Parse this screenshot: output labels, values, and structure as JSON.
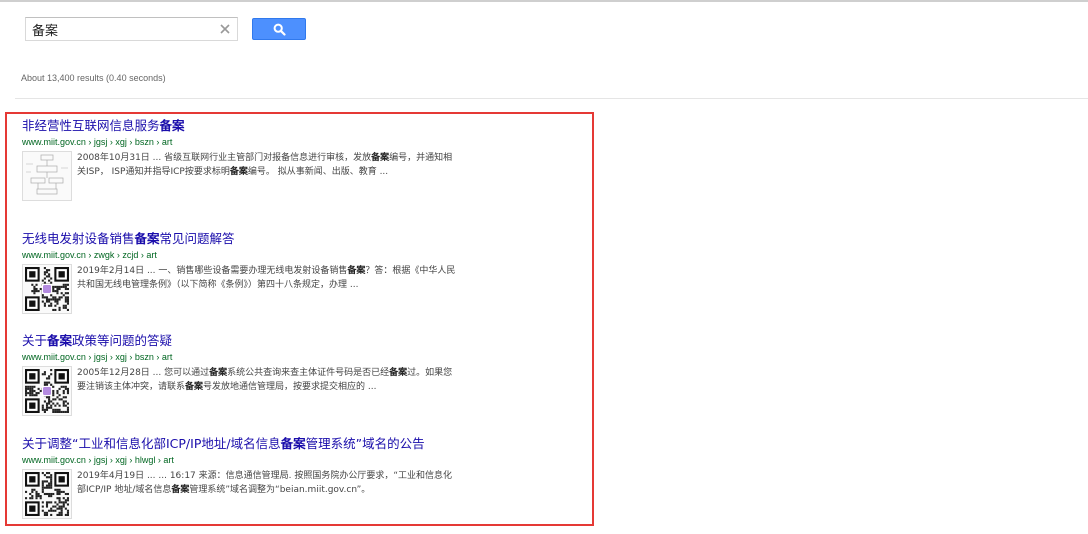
{
  "search": {
    "query": "备案",
    "stats": "About 13,400 results (0.40 seconds)"
  },
  "results": [
    {
      "title_pre": "非经营性互联网信息服务",
      "title_bold": "备案",
      "title_post": "",
      "url": "www.miit.gov.cn › jgsj › xgj › bszn › art",
      "snippet_parts": [
        {
          "t": "2008年10月31日 ... 省级互联网行业主管部门对报备信息进行审核，发放"
        },
        {
          "t": "备案",
          "b": true
        },
        {
          "t": "编号，并通知相关ISP， ISP通知并指导ICP按要求标明"
        },
        {
          "t": "备案",
          "b": true
        },
        {
          "t": "编号。 拟从事新闻、出版、教育 ..."
        }
      ],
      "thumb_icon": "flowchart-thumbnail"
    },
    {
      "title_pre": "无线电发射设备销售",
      "title_bold": "备案",
      "title_post": "常见问题解答",
      "url": "www.miit.gov.cn › zwgk › zcjd › art",
      "snippet_parts": [
        {
          "t": "2019年2月14日 ... 一、销售哪些设备需要办理无线电发射设备销售"
        },
        {
          "t": "备案",
          "b": true
        },
        {
          "t": "？答：根据《中华人民共和国无线电管理条例》（以下简称《条例》）第四十八条规定，办理 ..."
        }
      ],
      "thumb_icon": "qr-code-thumbnail"
    },
    {
      "title_pre": "关于",
      "title_bold": "备案",
      "title_post": "政策等问题的答疑",
      "url": "www.miit.gov.cn › jgsj › xgj › bszn › art",
      "snippet_parts": [
        {
          "t": "2005年12月28日 ... 您可以通过"
        },
        {
          "t": "备案",
          "b": true
        },
        {
          "t": "系统公共查询来查主体证件号码是否已经"
        },
        {
          "t": "备案",
          "b": true
        },
        {
          "t": "过。如果您要注销该主体冲突，请联系"
        },
        {
          "t": "备案",
          "b": true
        },
        {
          "t": "号发放地通信管理局，按要求提交相应的 ..."
        }
      ],
      "thumb_icon": "qr-code-thumbnail"
    },
    {
      "title_pre": "关于调整“工业和信息化部ICP/IP地址/域名信息",
      "title_bold": "备案",
      "title_post": "管理系统”域名的公告",
      "url": "www.miit.gov.cn › jgsj › xgj › hlwgl › art",
      "snippet_parts": [
        {
          "t": "2019年4月19日 ... ... 16:17 来源：信息通信管理局. 按照国务院办公厅要求，“工业和信息化部ICP/IP 地址/域名信息"
        },
        {
          "t": "备案",
          "b": true
        },
        {
          "t": "管理系统”域名调整为“beian.miit.gov.cn”。"
        }
      ],
      "thumb_icon": "qr-code-thumbnail"
    }
  ],
  "colors": {
    "title_link": "#1a0dab",
    "url_green": "#006621",
    "search_button": "#4d90fe",
    "highlight_border": "#e53935"
  },
  "icons": {
    "search_button": "magnifier-icon",
    "clear": "close-icon"
  }
}
